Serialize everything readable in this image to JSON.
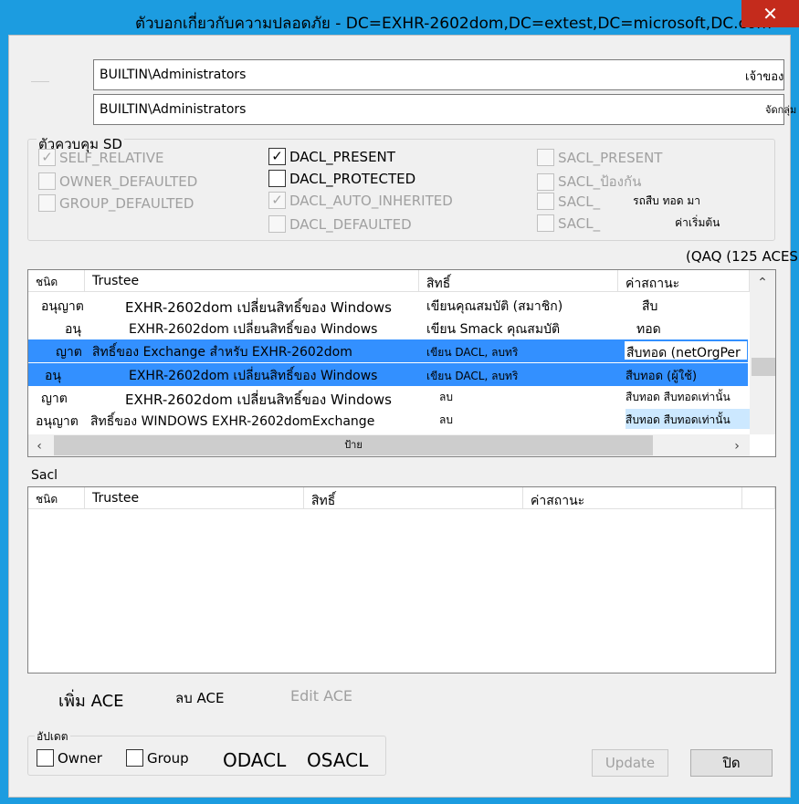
{
  "window": {
    "title": "ตัวบอกเกี่ยวกับความปลอดภัย - DC=EXHR-2602dom,DC=extest,DC=microsoft,DC.com",
    "close_glyph": "✕"
  },
  "owner": {
    "value": "BUILTIN\\Administrators",
    "side_label": "เจ้าของ"
  },
  "group": {
    "value": "BUILTIN\\Administrators",
    "side_label": "จัดกลุ่ม"
  },
  "sd_control": {
    "label": "ตัวควบคุม SD",
    "flags": [
      {
        "label": "SELF_RELATIVE",
        "checked": true,
        "enabled": false
      },
      {
        "label": "OWNER_DEFAULTED",
        "checked": false,
        "enabled": false
      },
      {
        "label": "GROUP_DEFAULTED",
        "checked": false,
        "enabled": false
      },
      {
        "label": "DACL_PRESENT",
        "checked": true,
        "enabled": true
      },
      {
        "label": "DACL_PROTECTED",
        "checked": false,
        "enabled": true
      },
      {
        "label": "DACL_AUTO_INHERITED",
        "checked": true,
        "enabled": false
      },
      {
        "label": "DACL_DEFAULTED",
        "checked": false,
        "enabled": false
      },
      {
        "label": "SACL_PRESENT",
        "checked": false,
        "enabled": false
      },
      {
        "label": "SACL_ป้องกัน",
        "checked": false,
        "enabled": false
      },
      {
        "label": "SACL_",
        "checked": false,
        "enabled": false,
        "extra": "รถสืบ ทอด มา"
      },
      {
        "label": "SACL_",
        "checked": false,
        "enabled": false,
        "extra": "ค่าเริ่มต้น"
      }
    ]
  },
  "dacl": {
    "count_label": "(QAQ (125 ACES",
    "columns": [
      "ชนิด",
      "Trustee",
      "สิทธิ์",
      "ค่าสถานะ"
    ],
    "rows": [
      {
        "type": "อนุญาต",
        "trustee": "EXHR-2602dom เปลี่ยนสิทธิ์ของ Windows",
        "rights": "เขียนคุณสมบัติ (สมาชิก)",
        "flags": "สืบ",
        "selected": false
      },
      {
        "type": "อนุ",
        "trustee": "EXHR-2602dom เปลี่ยนสิทธิ์ของ Windows",
        "rights": "เขียน Smack คุณสมบัติ",
        "flags": "ทอด",
        "selected": false
      },
      {
        "type": "ญาต",
        "trustee": "สิทธิ์ของ Exchange สำหรับ EXHR-2602dom",
        "rights": "เขียน DACL, ลบทริ",
        "flags": "สืบทอด (netOrgPer",
        "selected": true
      },
      {
        "type": "อนุ",
        "trustee": "EXHR-2602dom เปลี่ยนสิทธิ์ของ Windows",
        "rights": "เขียน DACL, ลบทริ",
        "flags": "สืบทอด (ผู้ใช้)",
        "selected": true
      },
      {
        "type": "ญาต",
        "trustee": "EXHR-2602dom เปลี่ยนสิทธิ์ของ Windows",
        "rights": "ลบ",
        "flags": "สืบทอด สืบทอดเท่านั้น",
        "selected": false
      },
      {
        "type": "อนุญาต",
        "trustee": "สิทธิ์ของ WINDOWS EXHR-2602domExchange",
        "rights": "ลบ",
        "flags": "สืบทอด สืบทอดเท่านั้น",
        "selected": false
      }
    ],
    "hscroll_label": "ป้าย"
  },
  "sacl": {
    "label": "Sacl",
    "columns": [
      "ชนิด",
      "Trustee",
      "สิทธิ์",
      "ค่าสถานะ"
    ]
  },
  "actions": {
    "add_ace": "เพิ่ม ACE",
    "remove_ace": "ลบ ACE",
    "edit_ace": "Edit ACE"
  },
  "update_group": {
    "label": "อัปเดต",
    "owner": "Owner",
    "group": "Group",
    "odacl": "ODACL",
    "osacl": "OSACL"
  },
  "buttons": {
    "update": "Update",
    "close": "ปิด"
  }
}
